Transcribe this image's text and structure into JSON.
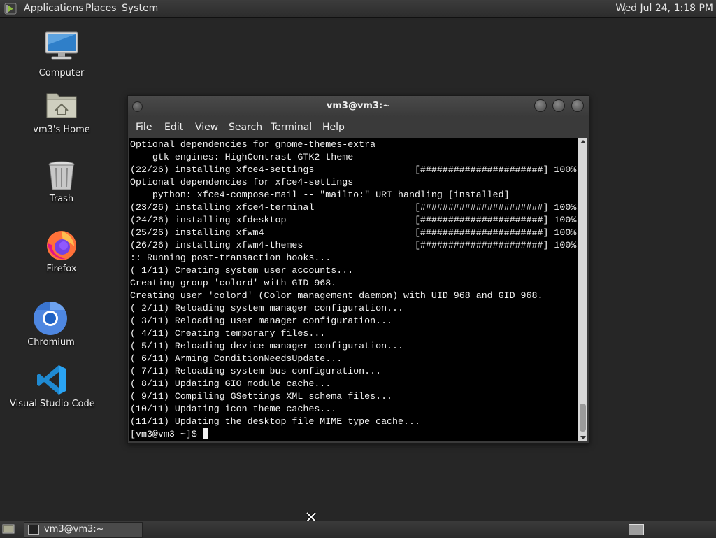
{
  "top_panel": {
    "menus": [
      "Applications",
      "Places",
      "System"
    ],
    "clock": "Wed Jul 24,  1:18 PM"
  },
  "desktop_icons": [
    {
      "label": "Computer",
      "icon": "computer-icon"
    },
    {
      "label": "vm3's Home",
      "icon": "home-folder-icon"
    },
    {
      "label": "Trash",
      "icon": "trash-icon"
    },
    {
      "label": "Firefox",
      "icon": "firefox-icon"
    },
    {
      "label": "Chromium",
      "icon": "chromium-icon"
    },
    {
      "label": "Visual Studio Code",
      "icon": "vscode-icon"
    }
  ],
  "terminal": {
    "title": "vm3@vm3:~",
    "menu": [
      "File",
      "Edit",
      "View",
      "Search",
      "Terminal",
      "Help"
    ],
    "lines": [
      "Optional dependencies for gnome-themes-extra",
      "    gtk-engines: HighContrast GTK2 theme",
      "(22/26) installing xfce4-settings                  [######################] 100%",
      "Optional dependencies for xfce4-settings",
      "    python: xfce4-compose-mail -- \"mailto:\" URI handling [installed]",
      "(23/26) installing xfce4-terminal                  [######################] 100%",
      "(24/26) installing xfdesktop                       [######################] 100%",
      "(25/26) installing xfwm4                           [######################] 100%",
      "(26/26) installing xfwm4-themes                    [######################] 100%",
      ":: Running post-transaction hooks...",
      "( 1/11) Creating system user accounts...",
      "Creating group 'colord' with GID 968.",
      "Creating user 'colord' (Color management daemon) with UID 968 and GID 968.",
      "( 2/11) Reloading system manager configuration...",
      "( 3/11) Reloading user manager configuration...",
      "( 4/11) Creating temporary files...",
      "( 5/11) Reloading device manager configuration...",
      "( 6/11) Arming ConditionNeedsUpdate...",
      "( 7/11) Reloading system bus configuration...",
      "( 8/11) Updating GIO module cache...",
      "( 9/11) Compiling GSettings XML schema files...",
      "(10/11) Updating icon theme caches...",
      "(11/11) Updating the desktop file MIME type cache..."
    ],
    "prompt": "[vm3@vm3 ~]$ "
  },
  "taskbar": {
    "task_label": "vm3@vm3:~"
  }
}
